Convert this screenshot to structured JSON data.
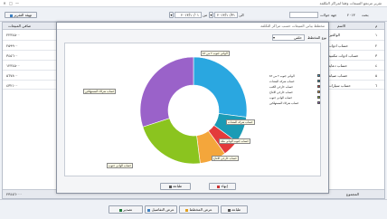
{
  "window": {
    "title": "تقرير مرتجع المبيعات وفقا لمراكز التكلفة",
    "minimize": "—",
    "maximize": "□",
    "close": "✕"
  },
  "toolbar": {
    "settings_button": "تهيئة التقرير",
    "date_from_label": "من",
    "date_from": "٢٠١٣/١٠/٠١",
    "date_to_label": "الى",
    "date_to": "٢٠١٣/١٠/٣١",
    "search_label": "بحث",
    "dropdown_value": "",
    "entity_label": "جهة جولات",
    "entity_value": "٢٠١٣"
  },
  "grid": {
    "columns": {
      "index": "م",
      "name": "الاسم",
      "value": "صافي المبيعات"
    },
    "rows": [
      {
        "index": "١",
        "name": "الوالعين",
        "value": "٢٢٣٤٥٠٠"
      },
      {
        "index": "٢",
        "name": "حساب ادوات",
        "value": "٢٥٩٩٠٠"
      },
      {
        "index": "٣",
        "name": "حساب ادوات مكتبية",
        "value": "٣٤٥٦٠٠"
      },
      {
        "index": "٤",
        "name": "حساب دعاية",
        "value": "١٢٣٤٥٠٠"
      },
      {
        "index": "٥",
        "name": "حساب صيانة",
        "value": "٥٦٧٨٠٠"
      },
      {
        "index": "٦",
        "name": "حساب سيارات",
        "value": "٤٣٢١٠٠"
      }
    ],
    "total_label": "المجموع",
    "total_value": "٢٣٤٥٦٠٠٠"
  },
  "modal": {
    "title": "مخطط بياني المبيعات حسب مراكز التكلفة",
    "chart_type_label": "نوع المخطط",
    "chart_type_value": "حلقي",
    "print_button": "طباعة",
    "close_button": "إنهاء"
  },
  "chart_data": {
    "type": "pie",
    "style": "doughnut",
    "legend_position": "right",
    "slices": [
      {
        "label": "الوادي جنوب ٢ من ٨٢",
        "value": 27,
        "color": "#2aa7e0"
      },
      {
        "label": "حساب شركة المعدات",
        "value": 8,
        "color": "#1b9bb5"
      },
      {
        "label": "حساب خارجي الكتب",
        "value": 5,
        "color": "#e33b3b"
      },
      {
        "label": "حساب خارجي الانتاج",
        "value": 8,
        "color": "#f4a63b"
      },
      {
        "label": "حساب الوادي جنوب",
        "value": 22,
        "color": "#8bc41f"
      },
      {
        "label": "حساب شركاء المستهلكين",
        "value": 30,
        "color": "#9a62c9"
      }
    ],
    "callouts": [
      "الوادي جنوب ٢ من ٨٢",
      "حساب شركاء المستهلكين",
      "حساب شركة المعدات",
      "حساب جنوب الوادي مكة",
      "حساب خارجي الانتاج",
      "حساب الوادي جنوب"
    ]
  },
  "bottom": {
    "print_button": "طباعة",
    "chart_button": "عرض المخطط",
    "details_button": "عرض التفاصيل",
    "excel_button": "تصدير"
  }
}
